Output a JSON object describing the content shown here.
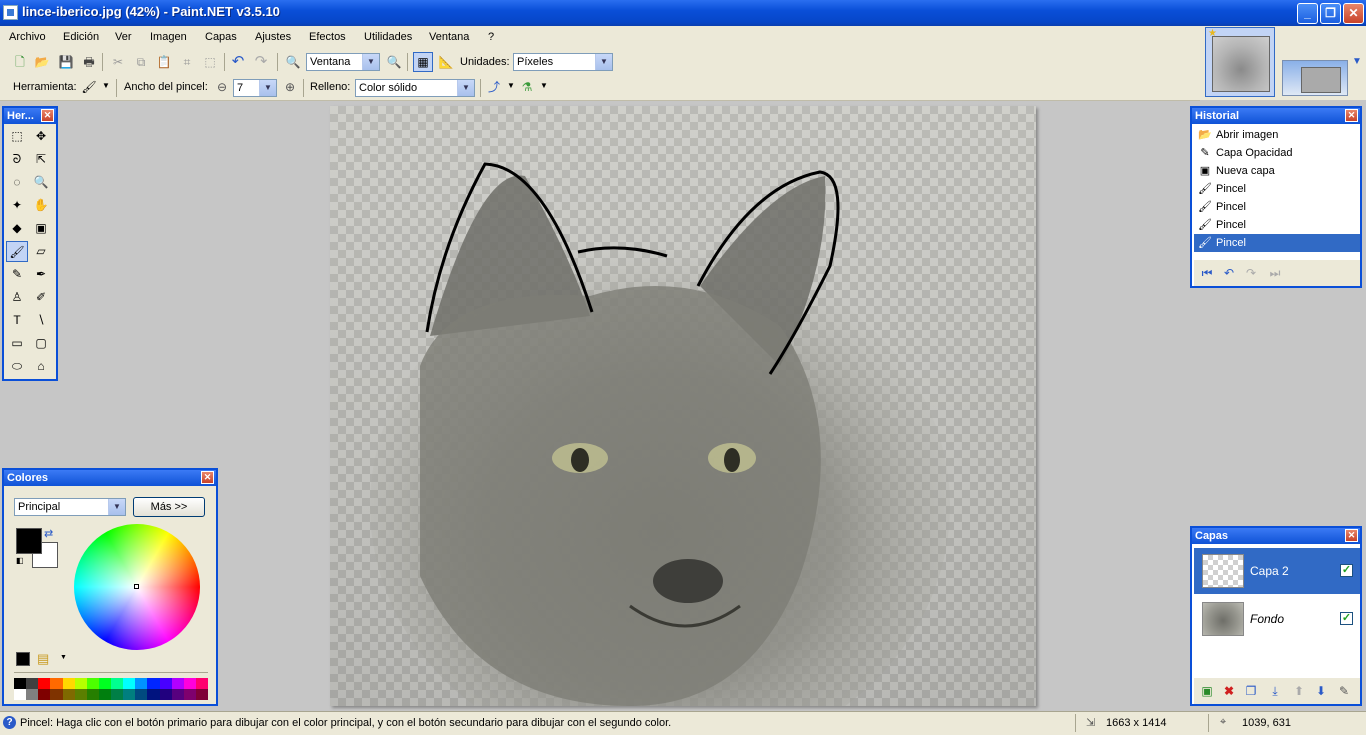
{
  "window": {
    "title": "lince-iberico.jpg (42%) - Paint.NET v3.5.10",
    "minimize": "_",
    "maximize": "❐",
    "close": "✕"
  },
  "menu": [
    "Archivo",
    "Edición",
    "Ver",
    "Imagen",
    "Capas",
    "Ajustes",
    "Efectos",
    "Utilidades",
    "Ventana",
    "?"
  ],
  "toolbar": {
    "zoom_value": "Ventana",
    "units_label": "Unidades:",
    "units_value": "Píxeles",
    "tool_label": "Herramienta:",
    "brush_width_label": "Ancho del pincel:",
    "brush_width_value": "7",
    "fill_label": "Relleno:",
    "fill_value": "Color sólido"
  },
  "tools_panel": {
    "title": "Her...",
    "close": "✕",
    "tools": [
      {
        "name": "rectangle-select",
        "glyph": "⬚"
      },
      {
        "name": "move-selected",
        "glyph": "✥"
      },
      {
        "name": "lasso-select",
        "glyph": "ᘐ"
      },
      {
        "name": "move-selection",
        "glyph": "⇱"
      },
      {
        "name": "ellipse-select",
        "glyph": "◌"
      },
      {
        "name": "zoom",
        "glyph": "🔍"
      },
      {
        "name": "magic-wand",
        "glyph": "✦"
      },
      {
        "name": "pan",
        "glyph": "✋"
      },
      {
        "name": "paint-bucket",
        "glyph": "◆"
      },
      {
        "name": "gradient",
        "glyph": "▣"
      },
      {
        "name": "paintbrush",
        "glyph": "🖌"
      },
      {
        "name": "eraser",
        "glyph": "▱"
      },
      {
        "name": "pencil",
        "glyph": "✎"
      },
      {
        "name": "color-picker",
        "glyph": "✒"
      },
      {
        "name": "clone-stamp",
        "glyph": "♙"
      },
      {
        "name": "recolor",
        "glyph": "✐"
      },
      {
        "name": "text",
        "glyph": "T"
      },
      {
        "name": "line-curve",
        "glyph": "∖"
      },
      {
        "name": "rectangle",
        "glyph": "▭"
      },
      {
        "name": "rounded-rectangle",
        "glyph": "▢"
      },
      {
        "name": "ellipse",
        "glyph": "⬭"
      },
      {
        "name": "freeform-shape",
        "glyph": "⌂"
      }
    ]
  },
  "history": {
    "title": "Historial",
    "close": "✕",
    "items": [
      {
        "label": "Abrir imagen",
        "icon": "open-image-icon"
      },
      {
        "label": "Capa Opacidad",
        "icon": "layer-opacity-icon"
      },
      {
        "label": "Nueva capa",
        "icon": "new-layer-icon"
      },
      {
        "label": "Pincel",
        "icon": "paintbrush-icon"
      },
      {
        "label": "Pincel",
        "icon": "paintbrush-icon"
      },
      {
        "label": "Pincel",
        "icon": "paintbrush-icon"
      },
      {
        "label": "Pincel",
        "icon": "paintbrush-icon"
      }
    ],
    "selected_index": 6
  },
  "layers": {
    "title": "Capas",
    "close": "✕",
    "items": [
      {
        "name": "Capa 2",
        "visible": true
      },
      {
        "name": "Fondo",
        "visible": true
      }
    ]
  },
  "colors": {
    "title": "Colores",
    "close": "✕",
    "mode_value": "Principal",
    "more_button": "Más >>",
    "primary": "#000000",
    "secondary": "#ffffff",
    "palette_top": [
      "#000000",
      "#404040",
      "#ff0000",
      "#ff6a00",
      "#ffd800",
      "#b6ff00",
      "#4cff00",
      "#00ff21",
      "#00ff90",
      "#00ffff",
      "#0094ff",
      "#0026ff",
      "#4800ff",
      "#b200ff",
      "#ff00dc",
      "#ff006e"
    ],
    "palette_bottom": [
      "#ffffff",
      "#808080",
      "#7f0000",
      "#7f3300",
      "#7f6a00",
      "#5b7f00",
      "#267f00",
      "#007f0e",
      "#007f46",
      "#007f7f",
      "#004a7f",
      "#00137f",
      "#21007f",
      "#57007f",
      "#7f006e",
      "#7f0037"
    ]
  },
  "status": {
    "message": "Pincel: Haga clic con el botón primario para dibujar con el color principal, y con el botón secundario para dibujar con el segundo color.",
    "image_size": "1663 x 1414",
    "cursor_position": "1039, 631"
  }
}
